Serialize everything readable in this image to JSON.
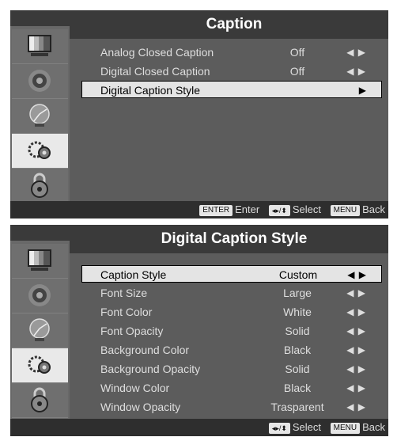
{
  "menu1": {
    "title": "Caption",
    "rows": [
      {
        "label": "Analog Closed Caption",
        "value": "Off",
        "arrows": "◀ ▶"
      },
      {
        "label": "Digital Closed Caption",
        "value": "Off",
        "arrows": "◀ ▶"
      },
      {
        "label": "Digital Caption Style",
        "value": "",
        "arrows": "▶"
      }
    ],
    "footer": {
      "enter_key": "ENTER",
      "enter_label": "Enter",
      "select_key": "◂▸/⬍",
      "select_label": "Select",
      "menu_key": "MENU",
      "back_label": "Back"
    }
  },
  "menu2": {
    "title": "Digital Caption Style",
    "rows": [
      {
        "label": "Caption Style",
        "value": "Custom",
        "arrows": "◀ ▶"
      },
      {
        "label": "Font Size",
        "value": "Large",
        "arrows": "◀ ▶"
      },
      {
        "label": "Font Color",
        "value": "White",
        "arrows": "◀ ▶"
      },
      {
        "label": "Font Opacity",
        "value": "Solid",
        "arrows": "◀ ▶"
      },
      {
        "label": "Background Color",
        "value": "Black",
        "arrows": "◀ ▶"
      },
      {
        "label": "Background Opacity",
        "value": "Solid",
        "arrows": "◀ ▶"
      },
      {
        "label": "Window Color",
        "value": "Black",
        "arrows": "◀ ▶"
      },
      {
        "label": "Window Opacity",
        "value": "Trasparent",
        "arrows": "◀ ▶"
      }
    ],
    "footer": {
      "select_key": "◂▸/⬍",
      "select_label": "Select",
      "menu_key": "MENU",
      "back_label": "Back"
    }
  },
  "sidebar_icons": [
    "picture-icon",
    "sound-icon",
    "channel-icon",
    "setup-icon",
    "lock-icon"
  ],
  "colors": {
    "panel": "#5c5c5c",
    "titlebar": "#3a3a3a",
    "selected": "#e4e4e4"
  }
}
